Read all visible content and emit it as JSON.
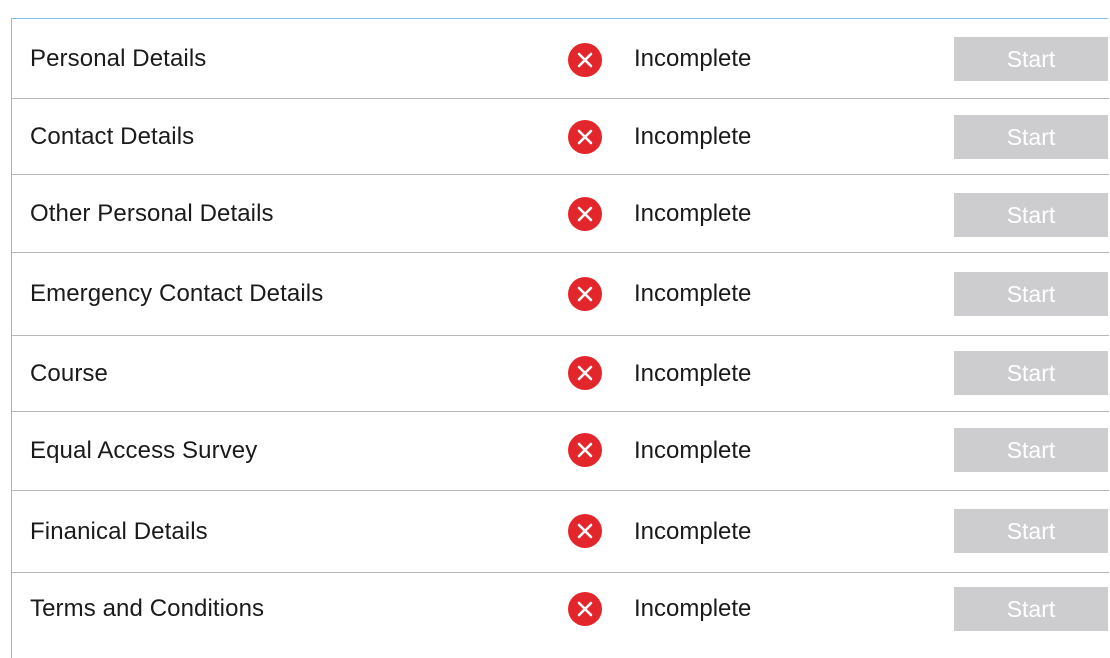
{
  "checklist": {
    "items": [
      {
        "label": "Personal Details",
        "status": "Incomplete",
        "action": "Start",
        "status_icon": "x-circle-icon"
      },
      {
        "label": "Contact Details",
        "status": "Incomplete",
        "action": "Start",
        "status_icon": "x-circle-icon"
      },
      {
        "label": "Other Personal Details",
        "status": "Incomplete",
        "action": "Start",
        "status_icon": "x-circle-icon"
      },
      {
        "label": "Emergency Contact Details",
        "status": "Incomplete",
        "action": "Start",
        "status_icon": "x-circle-icon"
      },
      {
        "label": "Course",
        "status": "Incomplete",
        "action": "Start",
        "status_icon": "x-circle-icon"
      },
      {
        "label": "Equal Access Survey",
        "status": "Incomplete",
        "action": "Start",
        "status_icon": "x-circle-icon"
      },
      {
        "label": "Finanical Details",
        "status": "Incomplete",
        "action": "Start",
        "status_icon": "x-circle-icon"
      },
      {
        "label": "Terms and Conditions",
        "status": "Incomplete",
        "action": "Start",
        "status_icon": "x-circle-icon"
      }
    ]
  },
  "colors": {
    "incomplete": "#e3262c",
    "start_button_bg": "#cdcdcf",
    "start_button_text": "#ffffff",
    "panel_border": "#7fc0e8",
    "row_divider": "#b8b8b8"
  }
}
